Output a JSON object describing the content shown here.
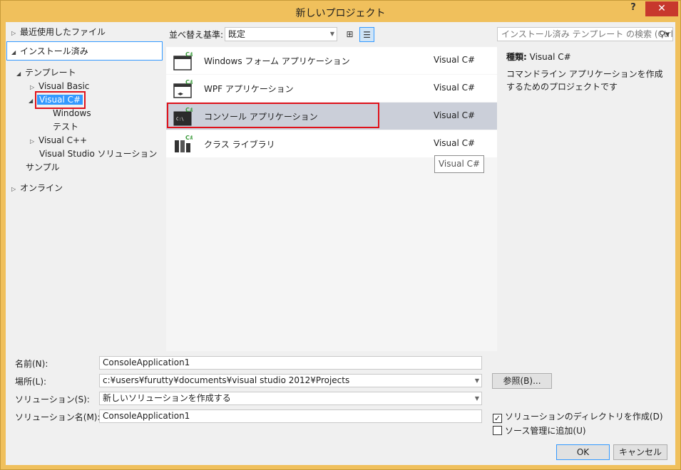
{
  "window": {
    "title": "新しいプロジェクト",
    "help": "?",
    "close": "✕"
  },
  "tree": {
    "recent": "最近使用したファイル",
    "installed": "インストール済み",
    "templates": "テンプレート",
    "vb": "Visual Basic",
    "vcs": "Visual C#",
    "windows": "Windows",
    "test": "テスト",
    "vcpp": "Visual C++",
    "vs_solution": "Visual Studio ソリューション",
    "samples": "サンプル",
    "online": "オンライン"
  },
  "toolbar": {
    "sort_label": "並べ替え基準:",
    "sort_value": "既定",
    "search_placeholder": "インストール済み テンプレート の検索 (Ctrl"
  },
  "templates": [
    {
      "name": "Windows フォーム アプリケーション",
      "lang": "Visual C#",
      "icon": "winforms-icon"
    },
    {
      "name": "WPF アプリケーション",
      "lang": "Visual C#",
      "icon": "wpf-icon"
    },
    {
      "name": "コンソール アプリケーション",
      "lang": "Visual C#",
      "icon": "console-icon"
    },
    {
      "name": "クラス ライブラリ",
      "lang": "Visual C#",
      "icon": "class-library-icon"
    }
  ],
  "tooltip": "Visual C#",
  "info": {
    "type_label": "種類:",
    "type_value": "Visual C#",
    "description": "コマンドライン アプリケーションを作成するためのプロジェクトです"
  },
  "form": {
    "name_label": "名前(N):",
    "name_value": "ConsoleApplication1",
    "location_label": "場所(L):",
    "location_value": "c:¥users¥furutty¥documents¥visual studio 2012¥Projects",
    "solution_label": "ソリューション(S):",
    "solution_value": "新しいソリューションを作成する",
    "solution_name_label": "ソリューション名(M):",
    "solution_name_value": "ConsoleApplication1",
    "browse": "参照(B)...",
    "create_dir": "ソリューションのディレクトリを作成(D)",
    "create_dir_checked": true,
    "source_control": "ソース管理に追加(U)",
    "source_control_checked": false,
    "ok": "OK",
    "cancel": "キャンセル"
  },
  "colors": {
    "accent": "#3399ff",
    "highlight_red": "#e0121b",
    "selected_row": "#cbcfd9",
    "title_bar": "#f0c05c"
  }
}
